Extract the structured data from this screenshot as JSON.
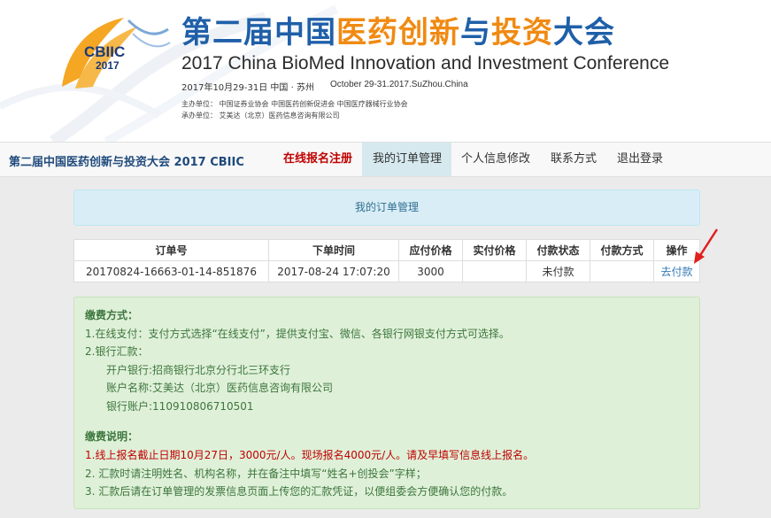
{
  "banner": {
    "logo_text": "CBIIC",
    "logo_year": "2017",
    "title_cn_part1": "第二届中国",
    "title_cn_part2": "医药创新",
    "title_cn_part3": "与",
    "title_cn_part4": "投资",
    "title_cn_part5": "大会",
    "title_en": "2017 China BioMed Innovation and Investment Conference",
    "date_cn": "2017年10月29-31日  中国 · 苏州",
    "date_en": "October 29-31.2017.SuZhou.China",
    "organizers": "主办单位： 中国证券业协会     中国医药创新促进会     中国医疗器械行业协会",
    "undertaker": "承办单位： 艾美达（北京）医药信息咨询有限公司"
  },
  "nav": {
    "brand": "第二届中国医药创新与投资大会 2017 CBIIC",
    "items": [
      {
        "label": "在线报名注册"
      },
      {
        "label": "我的订单管理"
      },
      {
        "label": "个人信息修改"
      },
      {
        "label": "联系方式"
      },
      {
        "label": "退出登录"
      }
    ]
  },
  "panel_title": "我的订单管理",
  "orders": {
    "columns": [
      "订单号",
      "下单时间",
      "应付价格",
      "实付价格",
      "付款状态",
      "付款方式",
      "操作"
    ],
    "rows": [
      {
        "order_no": "20170824-16663-01-14-851876",
        "time": "2017-08-24 17:07:20",
        "due": "3000",
        "paid": "",
        "status": "未付款",
        "method": "",
        "action": "去付款"
      }
    ]
  },
  "payment_info": {
    "heading": "缴费方式：",
    "line1": "1.在线支付：支付方式选择“在线支付”，提供支付宝、微信、各银行网银支付方式可选择。",
    "line2": "2.银行汇款：",
    "bank": "开户银行:招商银行北京分行北三环支行",
    "account_name": "账户名称:艾美达（北京）医药信息咨询有限公司",
    "account_no": "银行账户:110910806710501",
    "notes_heading": "缴费说明：",
    "note1": "1.线上报名截止日期10月27日，3000元/人。现场报名4000元/人。请及早填写信息线上报名。",
    "note2": "2. 汇款时请注明姓名、机构名称，并在备注中填写“姓名+创投会”字样；",
    "note3": "3. 汇款后请在订单管理的发票信息页面上传您的汇款凭证，以便组委会方便确认您的付款。"
  },
  "colors": {
    "brand_blue": "#1f5fa8",
    "brand_orange": "#f08a12",
    "active_tab": "#d5e9ef",
    "alert_red": "#c00000",
    "info_green": "#dff0d8",
    "heading_blue": "#d9edf7"
  }
}
